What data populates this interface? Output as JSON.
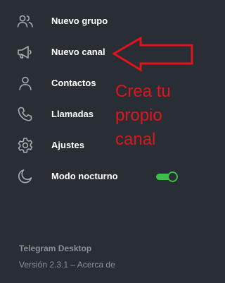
{
  "menu": {
    "items": [
      {
        "label": "Nuevo grupo",
        "icon": "group-icon"
      },
      {
        "label": "Nuevo canal",
        "icon": "megaphone-icon"
      },
      {
        "label": "Contactos",
        "icon": "person-icon"
      },
      {
        "label": "Llamadas",
        "icon": "phone-icon"
      },
      {
        "label": "Ajustes",
        "icon": "gear-icon"
      },
      {
        "label": "Modo nocturno",
        "icon": "moon-icon"
      }
    ],
    "night_mode_on": true
  },
  "annotation": {
    "text": "Crea tu propio canal",
    "color": "#e0141e"
  },
  "footer": {
    "app_name": "Telegram Desktop",
    "version_text": "Versión 2.3.1 – Acerca de"
  },
  "colors": {
    "background": "#282e33",
    "icon": "#a6adb2",
    "label": "#ffffff",
    "toggle_accent": "#3fbe4b",
    "muted_text": "#8a9197"
  }
}
